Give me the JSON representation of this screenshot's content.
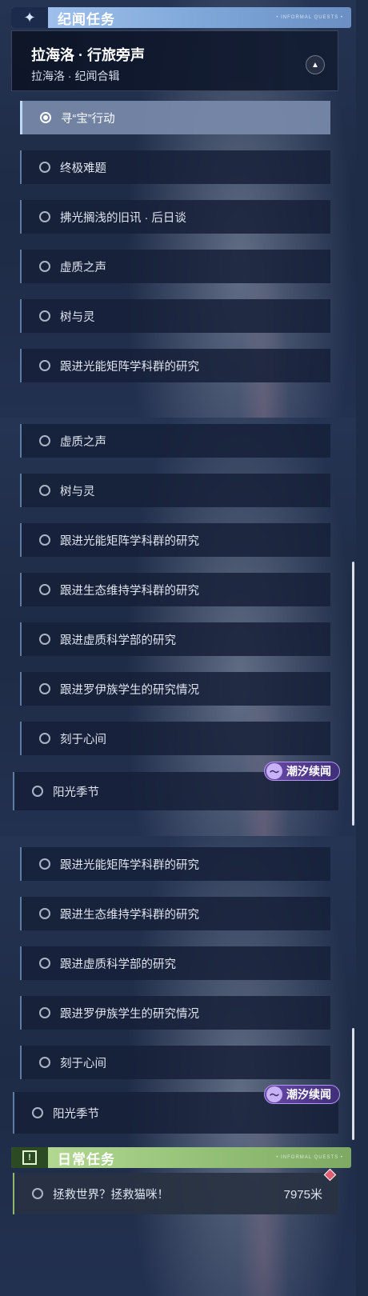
{
  "events_section": {
    "title": "纪闻任务",
    "deco": "• INFORMAL QUESTS •",
    "region_title": "拉海洛 · 行旅旁声",
    "region_subtitle": "拉海洛 · 纪闻合辑"
  },
  "panel1_quests": [
    {
      "label": "寻“宝”行动",
      "selected": true
    },
    {
      "label": "终极难题"
    },
    {
      "label": "拂光搁浅的旧讯 · 后日谈"
    },
    {
      "label": "虚质之声"
    },
    {
      "label": "树与灵"
    },
    {
      "label": "跟进光能矩阵学科群的研究"
    }
  ],
  "panel2_quests": [
    {
      "label": "虚质之声"
    },
    {
      "label": "树与灵"
    },
    {
      "label": "跟进光能矩阵学科群的研究"
    },
    {
      "label": "跟进生态维持学科群的研究"
    },
    {
      "label": "跟进虚质科学部的研究"
    },
    {
      "label": "跟进罗伊族学生的研究情况"
    },
    {
      "label": "刻于心间"
    }
  ],
  "panel2_tide_quest": {
    "label": "阳光季节",
    "badge": "潮汐续闻"
  },
  "panel3_quests": [
    {
      "label": "跟进光能矩阵学科群的研究"
    },
    {
      "label": "跟进生态维持学科群的研究"
    },
    {
      "label": "跟进虚质科学部的研究"
    },
    {
      "label": "跟进罗伊族学生的研究情况"
    },
    {
      "label": "刻于心间"
    }
  ],
  "panel3_tide_quest": {
    "label": "阳光季节",
    "badge": "潮汐续闻"
  },
  "daily_section": {
    "title": "日常任务",
    "deco": "• INFORMAL QUESTS •",
    "icon": "!",
    "quest_label": "拯救世界？拯救猫咪！",
    "quest_distance": "7975米"
  },
  "colors": {
    "events_header": "#7fa8d9",
    "daily_header": "#95c278",
    "tide_badge": "#6a49a8",
    "tracking_marker": "#e35b6e"
  },
  "icons": {
    "events_header": "sparkle-icon",
    "daily_header": "exclamation-icon",
    "region_toggle": "chevron-up-icon",
    "tide_badge": "wave-icon",
    "tracking": "diamond-marker-icon"
  }
}
